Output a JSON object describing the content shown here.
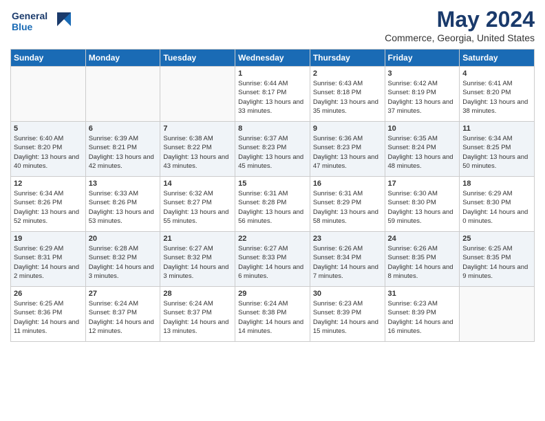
{
  "header": {
    "logo_line1": "General",
    "logo_line2": "Blue",
    "title": "May 2024",
    "subtitle": "Commerce, Georgia, United States"
  },
  "columns": [
    "Sunday",
    "Monday",
    "Tuesday",
    "Wednesday",
    "Thursday",
    "Friday",
    "Saturday"
  ],
  "weeks": [
    [
      {
        "day": "",
        "sunrise": "",
        "sunset": "",
        "daylight": ""
      },
      {
        "day": "",
        "sunrise": "",
        "sunset": "",
        "daylight": ""
      },
      {
        "day": "",
        "sunrise": "",
        "sunset": "",
        "daylight": ""
      },
      {
        "day": "1",
        "sunrise": "Sunrise: 6:44 AM",
        "sunset": "Sunset: 8:17 PM",
        "daylight": "Daylight: 13 hours and 33 minutes."
      },
      {
        "day": "2",
        "sunrise": "Sunrise: 6:43 AM",
        "sunset": "Sunset: 8:18 PM",
        "daylight": "Daylight: 13 hours and 35 minutes."
      },
      {
        "day": "3",
        "sunrise": "Sunrise: 6:42 AM",
        "sunset": "Sunset: 8:19 PM",
        "daylight": "Daylight: 13 hours and 37 minutes."
      },
      {
        "day": "4",
        "sunrise": "Sunrise: 6:41 AM",
        "sunset": "Sunset: 8:20 PM",
        "daylight": "Daylight: 13 hours and 38 minutes."
      }
    ],
    [
      {
        "day": "5",
        "sunrise": "Sunrise: 6:40 AM",
        "sunset": "Sunset: 8:20 PM",
        "daylight": "Daylight: 13 hours and 40 minutes."
      },
      {
        "day": "6",
        "sunrise": "Sunrise: 6:39 AM",
        "sunset": "Sunset: 8:21 PM",
        "daylight": "Daylight: 13 hours and 42 minutes."
      },
      {
        "day": "7",
        "sunrise": "Sunrise: 6:38 AM",
        "sunset": "Sunset: 8:22 PM",
        "daylight": "Daylight: 13 hours and 43 minutes."
      },
      {
        "day": "8",
        "sunrise": "Sunrise: 6:37 AM",
        "sunset": "Sunset: 8:23 PM",
        "daylight": "Daylight: 13 hours and 45 minutes."
      },
      {
        "day": "9",
        "sunrise": "Sunrise: 6:36 AM",
        "sunset": "Sunset: 8:23 PM",
        "daylight": "Daylight: 13 hours and 47 minutes."
      },
      {
        "day": "10",
        "sunrise": "Sunrise: 6:35 AM",
        "sunset": "Sunset: 8:24 PM",
        "daylight": "Daylight: 13 hours and 48 minutes."
      },
      {
        "day": "11",
        "sunrise": "Sunrise: 6:34 AM",
        "sunset": "Sunset: 8:25 PM",
        "daylight": "Daylight: 13 hours and 50 minutes."
      }
    ],
    [
      {
        "day": "12",
        "sunrise": "Sunrise: 6:34 AM",
        "sunset": "Sunset: 8:26 PM",
        "daylight": "Daylight: 13 hours and 52 minutes."
      },
      {
        "day": "13",
        "sunrise": "Sunrise: 6:33 AM",
        "sunset": "Sunset: 8:26 PM",
        "daylight": "Daylight: 13 hours and 53 minutes."
      },
      {
        "day": "14",
        "sunrise": "Sunrise: 6:32 AM",
        "sunset": "Sunset: 8:27 PM",
        "daylight": "Daylight: 13 hours and 55 minutes."
      },
      {
        "day": "15",
        "sunrise": "Sunrise: 6:31 AM",
        "sunset": "Sunset: 8:28 PM",
        "daylight": "Daylight: 13 hours and 56 minutes."
      },
      {
        "day": "16",
        "sunrise": "Sunrise: 6:31 AM",
        "sunset": "Sunset: 8:29 PM",
        "daylight": "Daylight: 13 hours and 58 minutes."
      },
      {
        "day": "17",
        "sunrise": "Sunrise: 6:30 AM",
        "sunset": "Sunset: 8:30 PM",
        "daylight": "Daylight: 13 hours and 59 minutes."
      },
      {
        "day": "18",
        "sunrise": "Sunrise: 6:29 AM",
        "sunset": "Sunset: 8:30 PM",
        "daylight": "Daylight: 14 hours and 0 minutes."
      }
    ],
    [
      {
        "day": "19",
        "sunrise": "Sunrise: 6:29 AM",
        "sunset": "Sunset: 8:31 PM",
        "daylight": "Daylight: 14 hours and 2 minutes."
      },
      {
        "day": "20",
        "sunrise": "Sunrise: 6:28 AM",
        "sunset": "Sunset: 8:32 PM",
        "daylight": "Daylight: 14 hours and 3 minutes."
      },
      {
        "day": "21",
        "sunrise": "Sunrise: 6:27 AM",
        "sunset": "Sunset: 8:32 PM",
        "daylight": "Daylight: 14 hours and 3 minutes."
      },
      {
        "day": "22",
        "sunrise": "Sunrise: 6:27 AM",
        "sunset": "Sunset: 8:33 PM",
        "daylight": "Daylight: 14 hours and 6 minutes."
      },
      {
        "day": "23",
        "sunrise": "Sunrise: 6:26 AM",
        "sunset": "Sunset: 8:34 PM",
        "daylight": "Daylight: 14 hours and 7 minutes."
      },
      {
        "day": "24",
        "sunrise": "Sunrise: 6:26 AM",
        "sunset": "Sunset: 8:35 PM",
        "daylight": "Daylight: 14 hours and 8 minutes."
      },
      {
        "day": "25",
        "sunrise": "Sunrise: 6:25 AM",
        "sunset": "Sunset: 8:35 PM",
        "daylight": "Daylight: 14 hours and 9 minutes."
      }
    ],
    [
      {
        "day": "26",
        "sunrise": "Sunrise: 6:25 AM",
        "sunset": "Sunset: 8:36 PM",
        "daylight": "Daylight: 14 hours and 11 minutes."
      },
      {
        "day": "27",
        "sunrise": "Sunrise: 6:24 AM",
        "sunset": "Sunset: 8:37 PM",
        "daylight": "Daylight: 14 hours and 12 minutes."
      },
      {
        "day": "28",
        "sunrise": "Sunrise: 6:24 AM",
        "sunset": "Sunset: 8:37 PM",
        "daylight": "Daylight: 14 hours and 13 minutes."
      },
      {
        "day": "29",
        "sunrise": "Sunrise: 6:24 AM",
        "sunset": "Sunset: 8:38 PM",
        "daylight": "Daylight: 14 hours and 14 minutes."
      },
      {
        "day": "30",
        "sunrise": "Sunrise: 6:23 AM",
        "sunset": "Sunset: 8:39 PM",
        "daylight": "Daylight: 14 hours and 15 minutes."
      },
      {
        "day": "31",
        "sunrise": "Sunrise: 6:23 AM",
        "sunset": "Sunset: 8:39 PM",
        "daylight": "Daylight: 14 hours and 16 minutes."
      },
      {
        "day": "",
        "sunrise": "",
        "sunset": "",
        "daylight": ""
      }
    ]
  ]
}
